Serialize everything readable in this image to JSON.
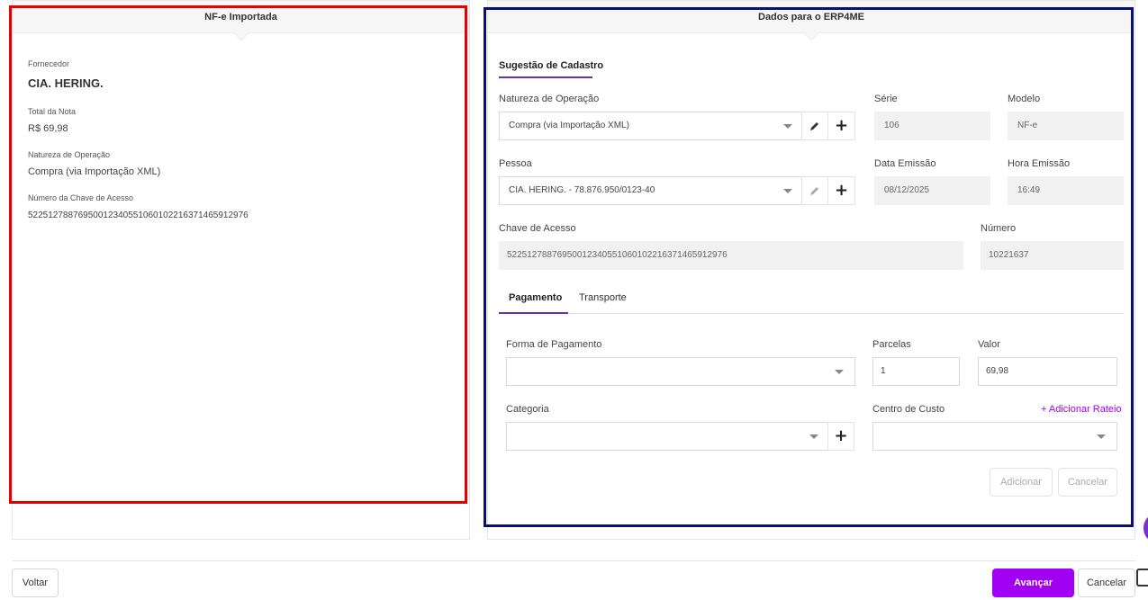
{
  "left_panel": {
    "title": "NF-e Importada",
    "fornecedor_label": "Fornecedor",
    "fornecedor_value": "CIA. HERING.",
    "total_label": "Total da Nota",
    "total_value": "R$ 69,98",
    "natureza_label": "Natureza de Operação",
    "natureza_value": "Compra (via Importação XML)",
    "chave_label": "Número da Chave de Acesso",
    "chave_value": "52251278876950012340551060102216371465912976"
  },
  "right_panel": {
    "title": "Dados para o ERP4ME",
    "section_tab": "Sugestão de Cadastro",
    "natureza_label": "Natureza de Operação",
    "natureza_value": "Compra (via Importação XML)",
    "serie_label": "Série",
    "serie_value": "106",
    "modelo_label": "Modelo",
    "modelo_value": "NF-e",
    "pessoa_label": "Pessoa",
    "pessoa_value": "CIA. HERING. - 78.876.950/0123-40",
    "data_label": "Data Emissão",
    "data_value": "08/12/2025",
    "hora_label": "Hora Emissão",
    "hora_value": "16:49",
    "chave_label": "Chave de Acesso",
    "chave_value": "52251278876950012340551060102216371465912976",
    "numero_label": "Número",
    "numero_value": "10221637",
    "tabs": [
      "Pagamento",
      "Transporte"
    ],
    "forma_label": "Forma de Pagamento",
    "forma_value": "",
    "parcelas_label": "Parcelas",
    "parcelas_value": "1",
    "valor_label": "Valor",
    "valor_value": "69,98",
    "categoria_label": "Categoria",
    "categoria_value": "",
    "centro_label": "Centro de Custo",
    "centro_value": "",
    "rateio_link": "+ Adicionar Rateio",
    "adicionar_btn": "Adicionar",
    "cancelar_btn": "Cancelar"
  },
  "footer": {
    "voltar": "Voltar",
    "avancar": "Avançar",
    "cancelar": "Cancelar"
  },
  "colors": {
    "accent": "#a100f2",
    "tab_underline": "#6b2fb8",
    "highlight_left": "#e60000",
    "highlight_right": "#0a1070"
  }
}
